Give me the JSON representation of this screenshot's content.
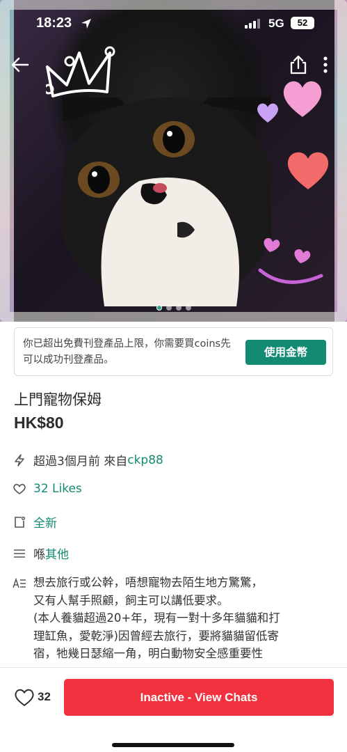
{
  "status_bar": {
    "time": "18:23",
    "network": "5G",
    "battery": "52"
  },
  "listing": {
    "notice_text": "你已超出免費刊登產品上限，你需要買coins先可以成功刊登產品。",
    "notice_button": "使用金幣",
    "title": "上門寵物保姆",
    "price": "HK$80",
    "posted_prefix": "超過3個月前 來自 ",
    "seller": "ckp88",
    "likes": "32 Likes",
    "condition": "全新",
    "category_prefix": "喺 ",
    "category": "其他",
    "description_lines": [
      "想去旅行或公幹，唔想寵物去陌生地方驚驚，",
      "又有人幫手照顧，飼主可以講低要求。",
      "(本人養貓超過20+年，現有一對十多年貓貓和打",
      "理缸魚，愛乾淨)因曾經去旅行，要將貓貓留低寄",
      "宿，牠幾日瑟縮一角，明白動物安全感重要性"
    ]
  },
  "bottom_bar": {
    "like_count": "32",
    "chat_button": "Inactive - View Chats"
  },
  "colors": {
    "accent_green": "#138a72",
    "cta_red": "#f2313e"
  },
  "icons": [
    "back-arrow-icon",
    "share-icon",
    "more-icon",
    "bolt-icon",
    "heart-icon",
    "condition-icon",
    "category-icon",
    "description-icon"
  ]
}
